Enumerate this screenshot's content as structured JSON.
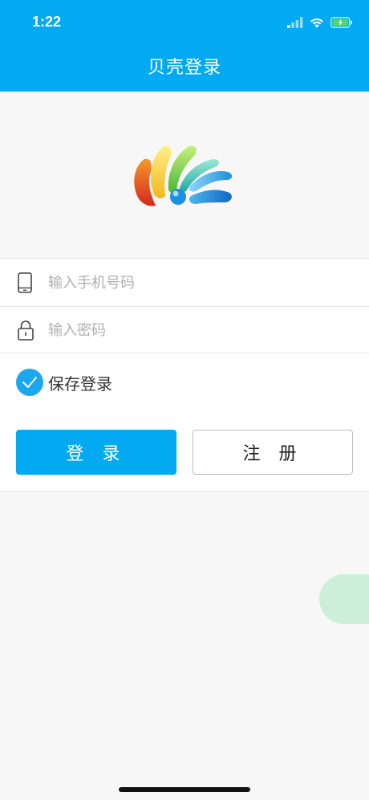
{
  "status_bar": {
    "time": "1:22"
  },
  "header": {
    "title": "贝壳登录"
  },
  "form": {
    "phone_placeholder": "输入手机号码",
    "password_placeholder": "输入密码"
  },
  "save_login": {
    "label": "保存登录",
    "checked": true
  },
  "buttons": {
    "login_label": "登 录",
    "register_label": "注 册"
  },
  "colors": {
    "primary": "#03a9f1",
    "check": "#1ba7ef",
    "floating": "#cdeed9",
    "background": "#f7f7f7"
  }
}
